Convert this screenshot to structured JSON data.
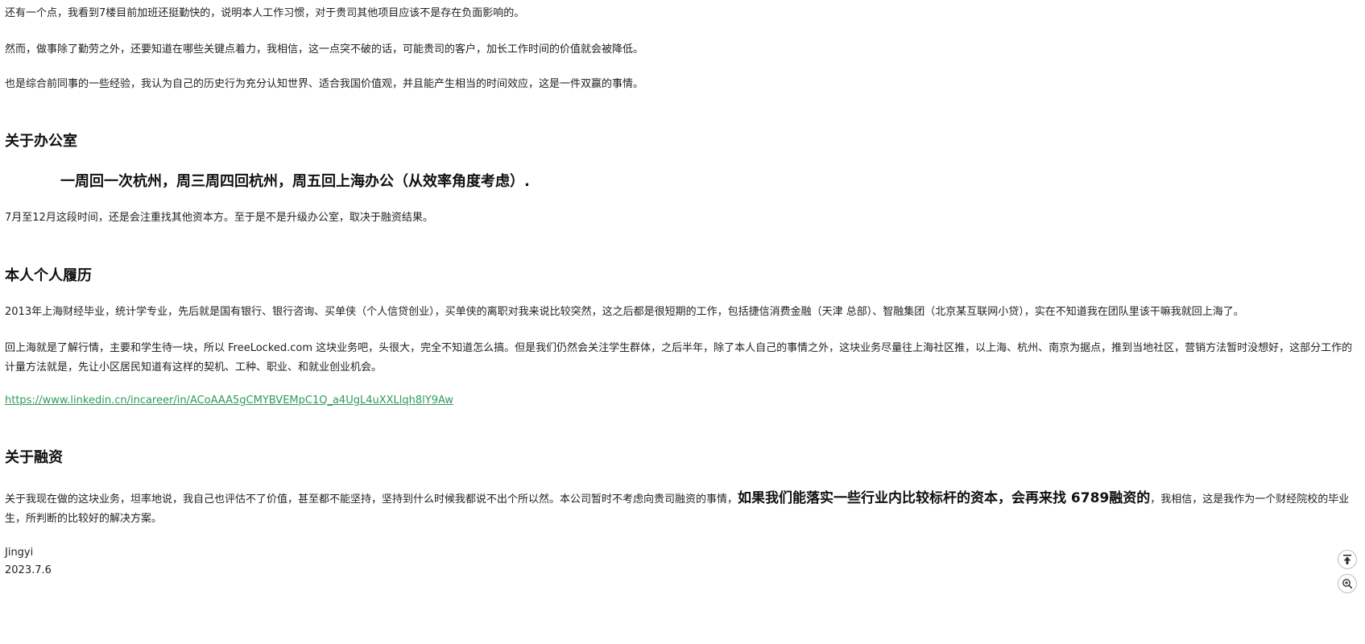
{
  "paragraphs_top": {
    "p1": "还有一个点，我看到7楼目前加班还挺勤快的，说明本人工作习惯，对于贵司其他项目应该不是存在负面影响的。",
    "p2": "然而，做事除了勤劳之外，还要知道在哪些关键点着力，我相信，这一点突不破的话，可能贵司的客户，加长工作时间的价值就会被降低。",
    "p3": "也是综合前同事的一些经验，我认为自己的历史行为充分认知世界、适合我国价值观，并且能产生相当的时间效应，这是一件双赢的事情。"
  },
  "office": {
    "heading": "关于办公室",
    "quote": "一周回一次杭州，周三周四回杭州，周五回上海办公（从效率角度考虑）.",
    "note": "7月至12月这段时间，还是会注重找其他资本方。至于是不是升级办公室，取决于融资结果。"
  },
  "resume": {
    "heading": "本人个人履历",
    "p1": "2013年上海财经毕业，统计学专业，先后就是国有银行、银行咨询、买单侠（个人信贷创业），买单侠的离职对我来说比较突然，这之后都是很短期的工作，包括捷信消费金融（天津 总部）、智融集团（北京某互联网小贷），实在不知道我在团队里该干嘛我就回上海了。",
    "p2": "回上海就是了解行情，主要和学生待一块，所以 FreeLocked.com 这块业务吧，头很大，完全不知道怎么搞。但是我们仍然会关注学生群体，之后半年，除了本人自己的事情之外，这块业务尽量往上海社区推，以上海、杭州、南京为据点，推到当地社区，营销方法暂时没想好，这部分工作的计量方法就是，先让小区居民知道有这样的契机、工种、职业、和就业创业机会。",
    "link": "https://www.linkedin.cn/incareer/in/ACoAAA5gCMYBVEMpC1Q_a4UgL4uXXLlqh8lY9Aw"
  },
  "financing": {
    "heading": "关于融资",
    "part1": "关于我现在做的这块业务，坦率地说，我自己也评估不了价值，甚至都不能坚持，坚持到什么时候我都说不出个所以然。本公司暂时不考虑向贵司融资的事情，",
    "emphasis": "如果我们能落实一些行业内比较标杆的资本，会再来找 6789融资的",
    "part2": "，我相信，这是我作为一个财经院校的毕业生，所判断的比较好的解决方案。"
  },
  "signature": {
    "name": "Jingyi",
    "date": "2023.7.6"
  },
  "tools": {
    "top_icon": "back-to-top-icon",
    "zoom_icon": "zoom-icon"
  }
}
